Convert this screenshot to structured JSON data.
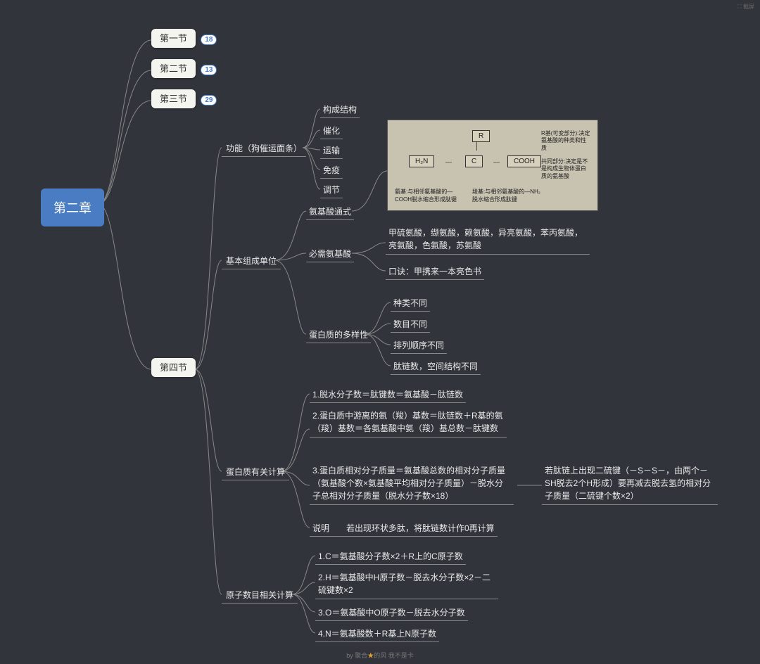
{
  "root": "第二章",
  "sections": {
    "s1": {
      "label": "第一节",
      "badge": "18"
    },
    "s2": {
      "label": "第二节",
      "badge": "13"
    },
    "s3": {
      "label": "第三节",
      "badge": "29"
    },
    "s4": {
      "label": "第四节"
    }
  },
  "func": {
    "title": "功能（狗催运面条）",
    "items": [
      "构成结构",
      "催化",
      "运输",
      "免疫",
      "调节"
    ]
  },
  "formula_title": "氨基酸通式",
  "formula_img": {
    "r": "R",
    "h2n": "H₂N",
    "c": "C",
    "cooh": "COOH",
    "note_r": "R基(可变部分):决定氨基酸的种类和性质",
    "note_common": "共同部分:决定是不是构成生物体蛋白质的氨基酸",
    "note_nh2": "氨基:与相邻氨基酸的—COOH脱水缩合形成肽键",
    "note_cooh": "羧基:与相邻氨基酸的—NH₂脱水缩合形成肽键"
  },
  "basic_unit": {
    "title": "基本组成单位",
    "essential": {
      "title": "必需氨基酸",
      "list": "甲硫氨酸，缬氨酸，赖氨酸，异亮氨酸，苯丙氨酸，亮氨酸，色氨酸，苏氨酸",
      "mnemonic": "口诀：甲携来一本亮色书"
    },
    "diversity": {
      "title": "蛋白质的多样性",
      "items": [
        "种类不同",
        "数目不同",
        "排列顺序不同",
        "肽链数，空间结构不同"
      ]
    }
  },
  "calc": {
    "title": "蛋白质有关计算",
    "items": [
      "1.脱水分子数＝肽键数＝氨基酸－肽链数",
      "2.蛋白质中游离的氨（羧）基数＝肽链数＋R基的氨（羧）基数＝各氨基酸中氨（羧）基总数－肽键数",
      "3.蛋白质相对分子质量＝氨基酸总数的相对分子质量（氨基酸个数×氨基酸平均相对分子质量）－脱水分子总相对分子质量（脱水分子数×18）",
      "说明　　若出现环状多肽，将肽链数计作0再计算"
    ],
    "extra": "若肽链上出现二硫键（－S－S－，由两个－SH脱去2个H形成）要再减去脱去氢的相对分子质量（二硫键个数×2）"
  },
  "atom": {
    "title": "原子数目相关计算",
    "items": [
      "1.C＝氨基酸分子数×2＋R上的C原子数",
      "2.H＝氨基酸中H原子数－脱去水分子数×2－二硫键数×2",
      "3.O＝氨基酸中O原子数－脱去水分子数",
      "4.N＝氨基酸数＋R基上N原子数"
    ]
  },
  "corner": "⛶ 截屏",
  "footer": {
    "pre": "by 聚合",
    "star": "★",
    "post": "的风 我不是卡"
  }
}
